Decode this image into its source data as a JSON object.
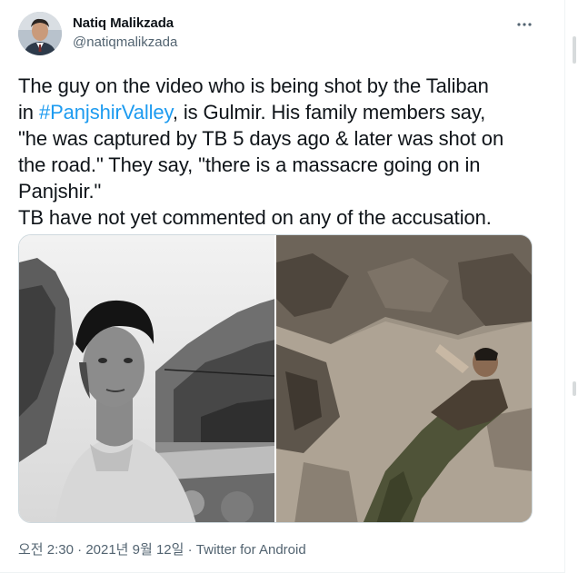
{
  "author": {
    "name": "Natiq Malikzada",
    "handle": "@natiqmalikzada",
    "avatar_icon": "profile-photo"
  },
  "more_icon": "ellipsis-icon",
  "tweet": {
    "line1": "The guy on the video who is being shot by the Taliban",
    "line2_pre": "in ",
    "hashtag": "#PanjshirValley",
    "line2_post": ", is Gulmir. His family members say,",
    "line3": "\"he was captured by TB 5 days ago & later was shot on",
    "line4": "the road.\" They say, \"there is a massacre going on in",
    "line5": "Panjshir.\"",
    "line6": "TB have not yet commented on any of the accusation."
  },
  "media": {
    "left": "photo-man-mountains-bw",
    "right": "video-still-man-on-ground"
  },
  "meta": {
    "time": "오전 2:30",
    "separator": " · ",
    "date": "2021년 9월 12일",
    "source": "Twitter for Android"
  },
  "colors": {
    "hashtag": "#1d9bf0",
    "text": "#0f1419",
    "secondary": "#536471"
  }
}
